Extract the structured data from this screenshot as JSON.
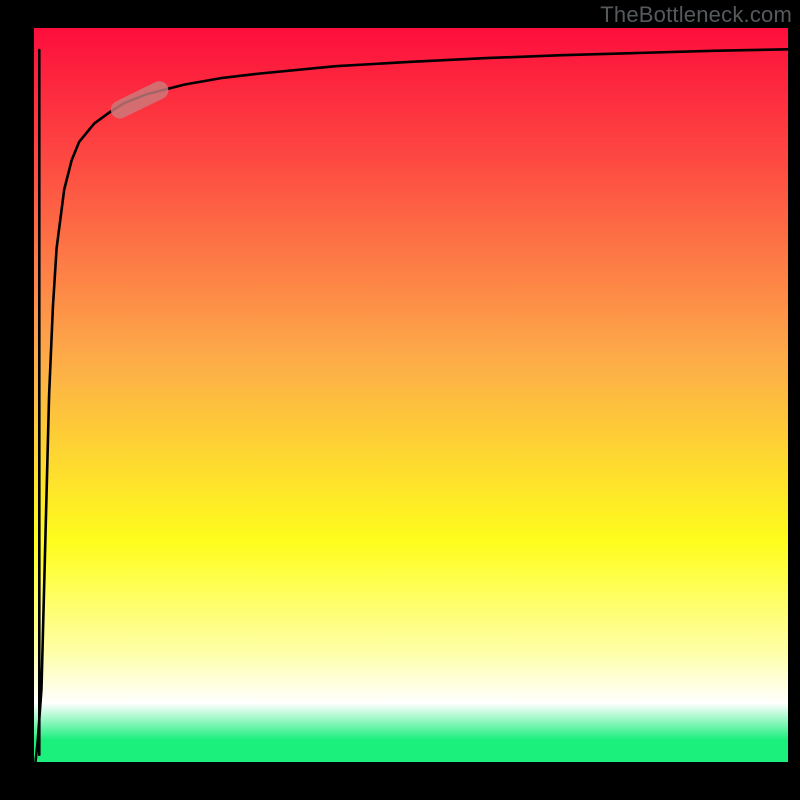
{
  "watermark": "TheBottleneck.com",
  "colors": {
    "frame": "#000000",
    "curve": "#000000",
    "marker_fill": "#cb7b7b",
    "gradient_top": "#fd0e3c",
    "gradient_red_mid": "#fd4942",
    "gradient_orange": "#fdab49",
    "gradient_yellow": "#fefd1c",
    "gradient_yellow_pale": "#feffa7",
    "gradient_white": "#ffffff",
    "gradient_green": "#1bef7c"
  },
  "chart_data": {
    "type": "line",
    "title": "",
    "xlabel": "",
    "ylabel": "",
    "xlim": [
      0,
      100
    ],
    "ylim": [
      0,
      100
    ],
    "series": [
      {
        "name": "bottleneck-curve",
        "x": [
          0.2,
          0.5,
          1.0,
          1.5,
          2.0,
          2.5,
          3.0,
          4.0,
          5.0,
          6.0,
          8.0,
          10.0,
          12.0,
          15.0,
          20.0,
          25.0,
          30.0,
          40.0,
          50.0,
          60.0,
          70.0,
          80.0,
          90.0,
          100.0
        ],
        "y": [
          0.0,
          3.0,
          10.0,
          30.0,
          50.0,
          62.0,
          70.0,
          78.0,
          82.0,
          84.5,
          87.0,
          88.5,
          89.8,
          91.0,
          92.3,
          93.2,
          93.8,
          94.8,
          95.4,
          95.9,
          96.3,
          96.6,
          96.9,
          97.1
        ]
      }
    ],
    "marker": {
      "series": "bottleneck-curve",
      "x_center": 14.0,
      "y_center": 90.2,
      "angle_deg": -26
    },
    "background_gradient_stops": [
      {
        "offset": 0.0,
        "color": "#fd0e3c"
      },
      {
        "offset": 0.18,
        "color": "#fd4942"
      },
      {
        "offset": 0.45,
        "color": "#fdab49"
      },
      {
        "offset": 0.7,
        "color": "#fefd1c"
      },
      {
        "offset": 0.85,
        "color": "#feffa7"
      },
      {
        "offset": 0.92,
        "color": "#ffffff"
      },
      {
        "offset": 0.97,
        "color": "#1bef7c"
      },
      {
        "offset": 1.0,
        "color": "#1bef7c"
      }
    ]
  }
}
